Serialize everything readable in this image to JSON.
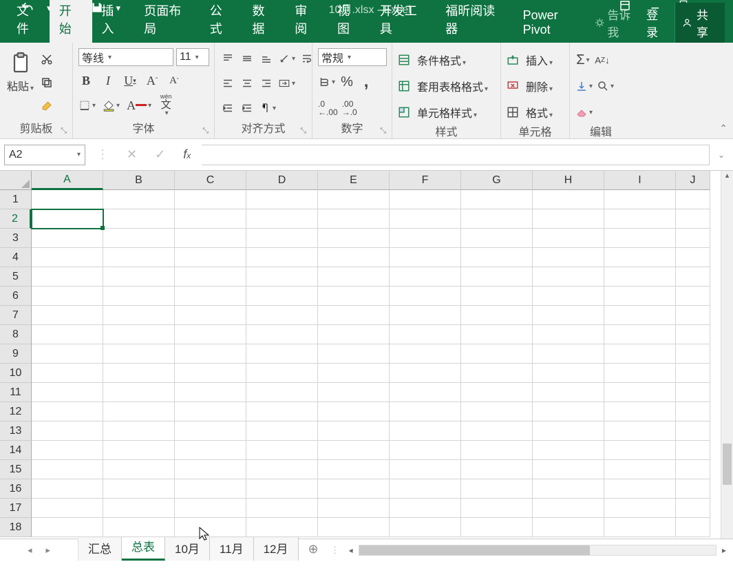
{
  "title": "10月.xlsx - Excel",
  "menu": {
    "file": "文件",
    "home": "开始",
    "insert": "插入",
    "layout": "页面布局",
    "formula": "公式",
    "data": "数据",
    "review": "审阅",
    "view": "视图",
    "dev": "开发工具",
    "foxit": "福昕阅读器",
    "pp": "Power Pivot",
    "tell": "告诉我",
    "login": "登录",
    "share": "共享"
  },
  "ribbon": {
    "clipboard": {
      "paste": "粘贴",
      "label": "剪贴板"
    },
    "font": {
      "name": "等线",
      "size": "11",
      "label": "字体",
      "wen": "wén",
      "wenchar": "文"
    },
    "align": {
      "label": "对齐方式"
    },
    "number": {
      "format": "常规",
      "label": "数字"
    },
    "styles": {
      "cond": "条件格式",
      "table": "套用表格格式",
      "cell": "单元格样式",
      "label": "样式"
    },
    "cells": {
      "insert": "插入",
      "delete": "删除",
      "format": "格式",
      "label": "单元格"
    },
    "editing": {
      "label": "编辑"
    }
  },
  "namebox": "A2",
  "columns": [
    "A",
    "B",
    "C",
    "D",
    "E",
    "F",
    "G",
    "H",
    "I",
    "J"
  ],
  "rows": [
    "1",
    "2",
    "3",
    "4",
    "5",
    "6",
    "7",
    "8",
    "9",
    "10",
    "11",
    "12",
    "13",
    "14",
    "15",
    "16",
    "17",
    "18"
  ],
  "active": {
    "col": "A",
    "row": "2"
  },
  "sheets": {
    "s1": "汇总",
    "s2": "总表",
    "s3": "10月",
    "s4": "11月",
    "s5": "12月"
  }
}
